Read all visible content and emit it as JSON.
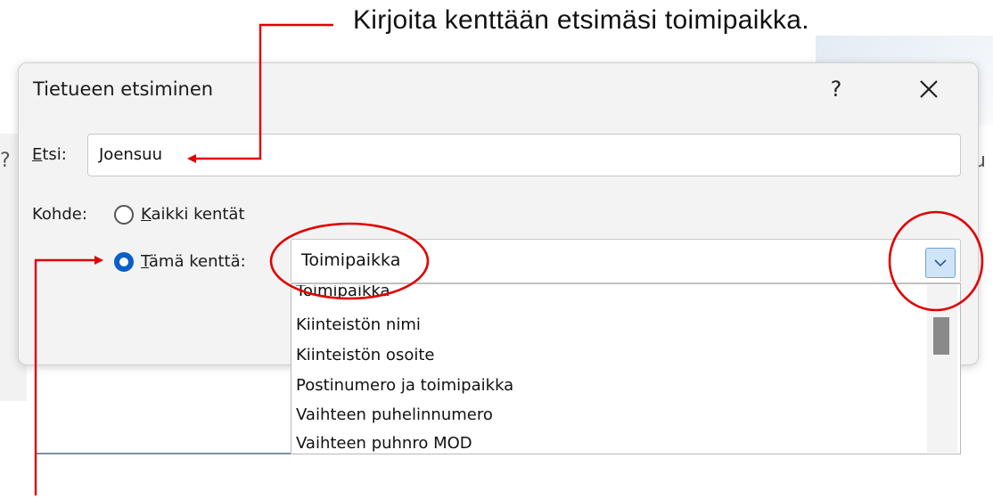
{
  "annotation": {
    "text": "Kirjoita kenttään etsimäsi toimipaikka."
  },
  "dialog": {
    "title": "Tietueen etsiminen",
    "help_label": "?",
    "close_label": "✕"
  },
  "search": {
    "label_accel": "E",
    "label_rest": "tsi:",
    "value": "Joensuu"
  },
  "scope": {
    "label": "Kohde:",
    "all_fields": {
      "accel": "K",
      "rest": "aikki kentät",
      "selected": false
    },
    "this_field": {
      "accel": "T",
      "rest": "ämä kenttä:",
      "selected": true
    }
  },
  "field_select": {
    "value": "Toimipaikka",
    "options": [
      "Toimipaikka",
      "Kiinteistön nimi",
      "Kiinteistön osoite",
      "Postinumero ja toimipaikka",
      "Vaihteen puhelinnumero",
      "Vaihteen puhnro MOD"
    ]
  },
  "background": {
    "left_edge": "?",
    "right_edge": "u"
  },
  "colors": {
    "arrow": "#e00000",
    "accent": "#0a5fc8",
    "highlight": "#e00000"
  }
}
